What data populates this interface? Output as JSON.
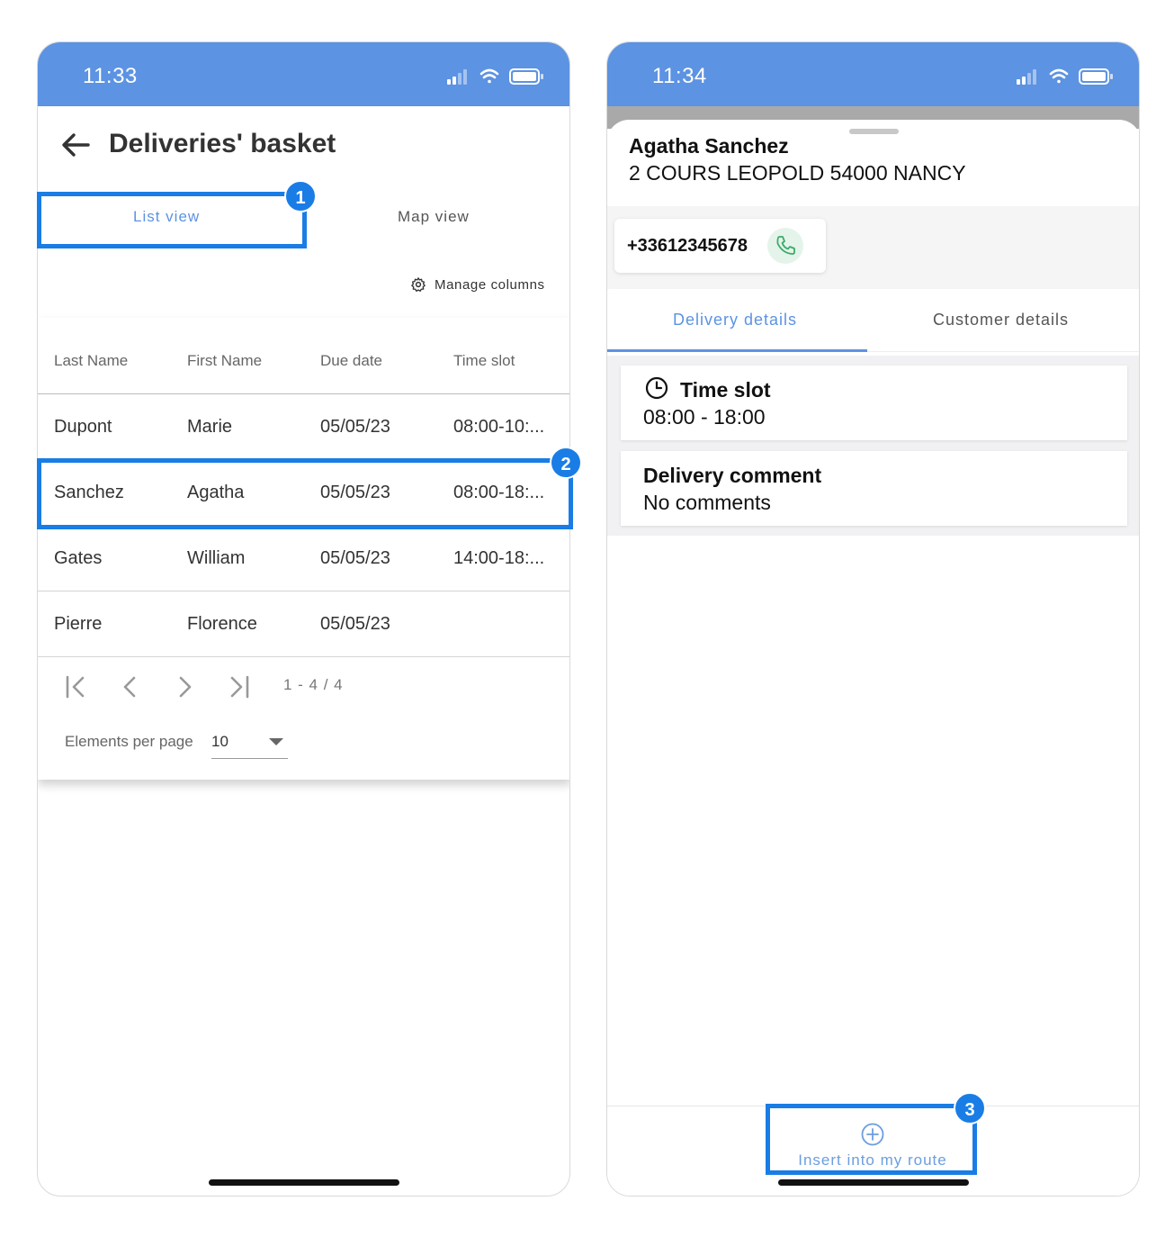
{
  "colors": {
    "status_bar": "#5c93e2",
    "highlight": "#1a7de6",
    "tab_active": "#5c93e2",
    "tab_inactive": "#555555",
    "call_icon": "#3dab6a"
  },
  "left_screen": {
    "status_time": "11:33",
    "title": "Deliveries' basket",
    "tabs": [
      {
        "label": "List view",
        "active": true
      },
      {
        "label": "Map view",
        "active": false
      }
    ],
    "manage_columns_label": "Manage columns",
    "table": {
      "headers": [
        "Last Name",
        "First Name",
        "Due date",
        "Time slot"
      ],
      "rows": [
        [
          "Dupont",
          "Marie",
          "05/05/23",
          "08:00-10:..."
        ],
        [
          "Sanchez",
          "Agatha",
          "05/05/23",
          "08:00-18:..."
        ],
        [
          "Gates",
          "William",
          "05/05/23",
          "14:00-18:..."
        ],
        [
          "Pierre",
          "Florence",
          "05/05/23",
          ""
        ]
      ]
    },
    "pagination": {
      "range": "1 - 4 / 4",
      "elements_per_page_label": "Elements per page",
      "elements_per_page_value": "10"
    },
    "badges": [
      "1",
      "2"
    ]
  },
  "right_screen": {
    "status_time": "11:34",
    "customer_name": "Agatha Sanchez",
    "customer_address": "2 COURS LEOPOLD 54000 NANCY",
    "phone_number": "+33612345678",
    "tabs": [
      {
        "label": "Delivery details",
        "active": true
      },
      {
        "label": "Customer details",
        "active": false
      }
    ],
    "details": [
      {
        "title": "Time slot",
        "value": "08:00 - 18:00",
        "icon": "clock-icon"
      },
      {
        "title": "Delivery comment",
        "value": "No comments"
      }
    ],
    "insert_button_label": "Insert into my route",
    "badges": [
      "3"
    ]
  }
}
